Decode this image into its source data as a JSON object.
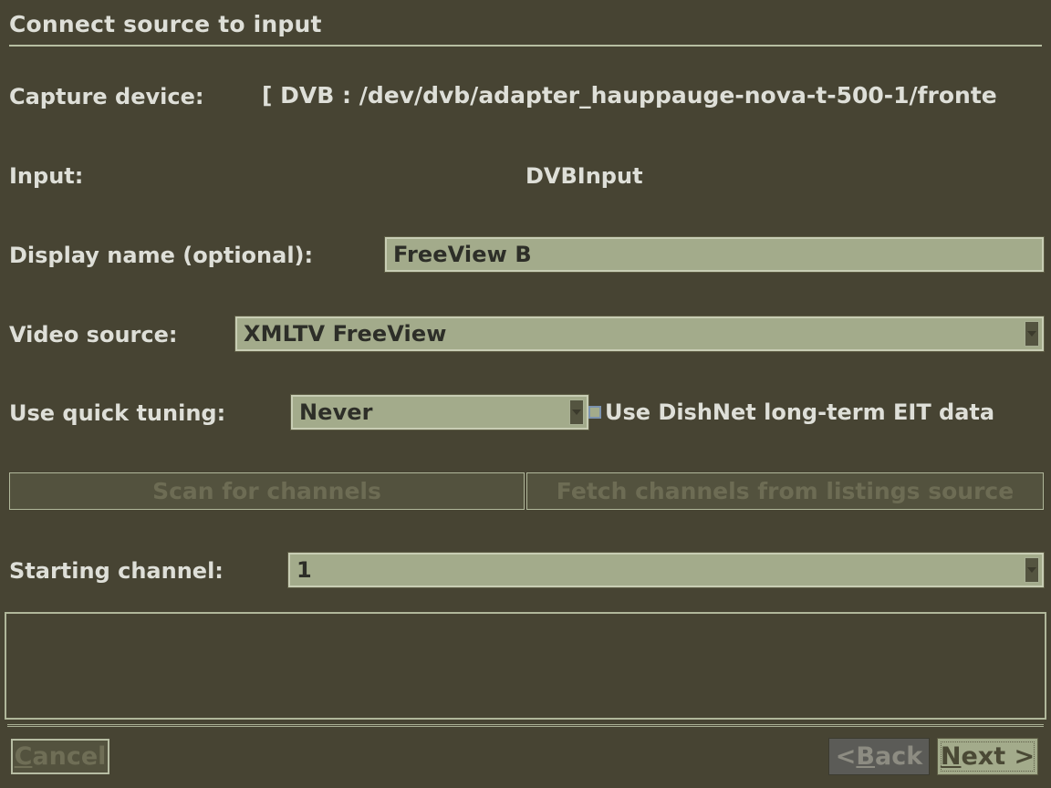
{
  "window": {
    "title": "Connect source to input"
  },
  "form": {
    "capture_device": {
      "label": "Capture device:",
      "value": "[ DVB : /dev/dvb/adapter_hauppauge-nova-t-500-1/fronte"
    },
    "input": {
      "label": "Input:",
      "value": "DVBInput"
    },
    "display_name": {
      "label": "Display name (optional):",
      "value": "FreeView B"
    },
    "video_source": {
      "label": "Video source:",
      "value": "XMLTV FreeView"
    },
    "quick_tuning": {
      "label": "Use quick tuning:",
      "value": "Never"
    },
    "dishnet_eit": {
      "label": "Use DishNet long-term EIT data",
      "checked": false
    },
    "starting_channel": {
      "label": "Starting channel:",
      "value": "1"
    }
  },
  "actions": {
    "scan_for_channels": "Scan for channels",
    "fetch_channels": "Fetch channels from listings source"
  },
  "help_panel": {
    "text": ""
  },
  "footer": {
    "cancel": {
      "mnemonic": "C",
      "rest": "ancel"
    },
    "back": {
      "prefix": "< ",
      "mnemonic": "B",
      "rest": "ack"
    },
    "next": {
      "mnemonic": "N",
      "rest": "ext >"
    }
  },
  "colors": {
    "window_background": "#474433",
    "field_background": "#a3ab8b",
    "field_border": "#c8cdb4",
    "text": "#dedfd8",
    "disabled_text": "#6d6c54",
    "back_button_background": "#5b5b57",
    "checkbox_border": "#7c93ae"
  }
}
